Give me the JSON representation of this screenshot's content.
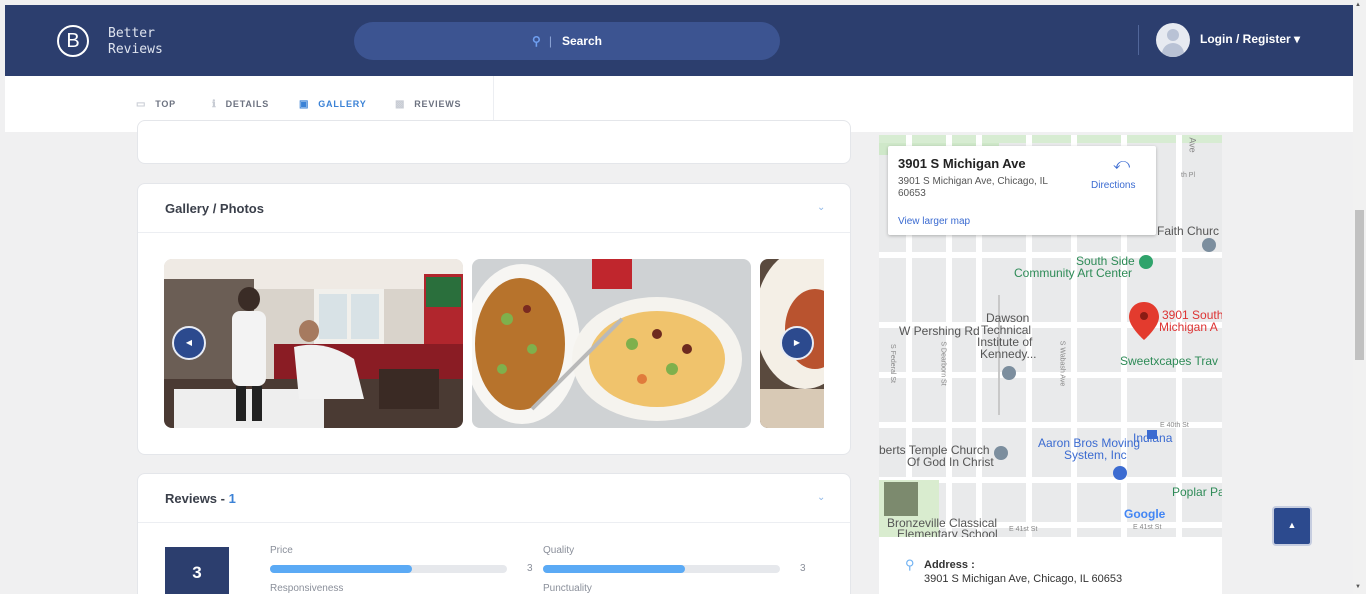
{
  "header": {
    "logo_letter": "B",
    "logo_line1": "Better",
    "logo_line2": "Reviews",
    "search_label": "Search",
    "login_label": "Login / Register ▾"
  },
  "tabs": [
    {
      "label": "TOP",
      "icon": "tag-icon"
    },
    {
      "label": "DETAILS",
      "icon": "info-icon"
    },
    {
      "label": "GALLERY",
      "icon": "image-icon",
      "active": true
    },
    {
      "label": "REVIEWS",
      "icon": "chat-icon"
    }
  ],
  "gallery": {
    "title": "Gallery / Photos"
  },
  "reviews": {
    "title": "Reviews - ",
    "count": "1",
    "score": "3",
    "criteria": [
      {
        "label": "Price",
        "value": "3",
        "fraction": 0.6
      },
      {
        "label": "Quality",
        "value": "3",
        "fraction": 0.6
      },
      {
        "label": "Responsiveness"
      },
      {
        "label": "Punctuality"
      }
    ]
  },
  "map": {
    "place_title": "3901 S Michigan Ave",
    "place_address": "3901 S Michigan Ave, Chicago, IL 60653",
    "directions": "Directions",
    "view_larger": "View larger map",
    "labels": {
      "faith": "Faith Churc",
      "south_side_1": "South Side",
      "south_side_2": "Community Art Center",
      "pin_1": "3901 South",
      "pin_2": "Michigan A",
      "dawson_1": "Dawson",
      "dawson_2": "Technical",
      "dawson_3": "Institute of",
      "dawson_4": "Kennedy...",
      "pershing": "W Pershing Rd",
      "sweetx": "Sweetxcapes Trav",
      "indiana": "Indiana",
      "e40": "E 40th St",
      "aaron_1": "Aaron Bros Moving",
      "aaron_2": "System, Inc",
      "temple_1": "berts Temple Church",
      "temple_2": "Of God In Christ",
      "poplar": "Poplar Pa",
      "bronze_1": "Bronzeville Classical",
      "bronze_2": "Elementary School",
      "e41a": "E 41st St",
      "e41b": "E 41st St",
      "google": "Google",
      "ave": "Ave",
      "thpl": "th Pl",
      "federal": "S Federal St",
      "dearborn": "S Dearborn St",
      "wabash": "S Wabash Ave"
    }
  },
  "address": {
    "label": "Address :",
    "value": "3901 S Michigan Ave, Chicago, IL 60653"
  },
  "colors": {
    "header_bg": "#2c3e6e",
    "accent": "#3b82d6",
    "bar_fill": "#5baaf5"
  }
}
